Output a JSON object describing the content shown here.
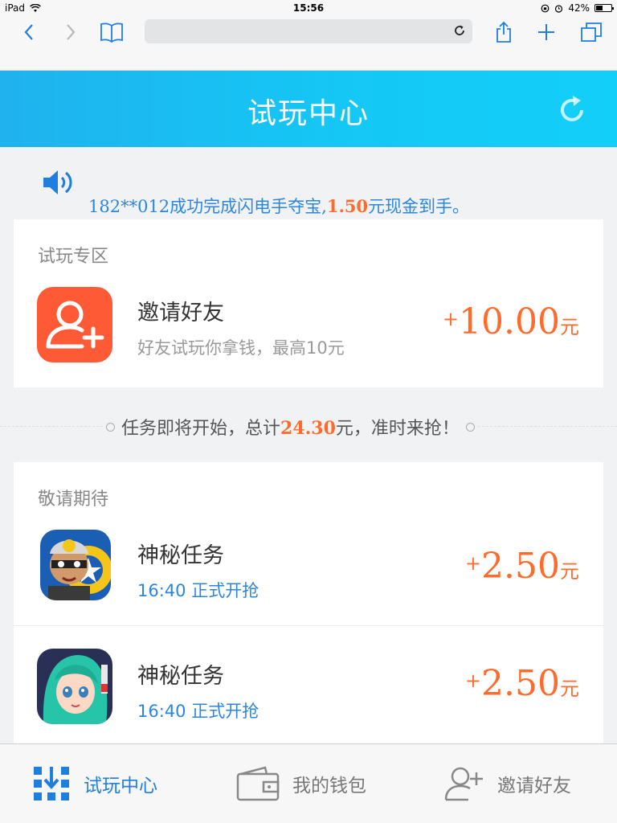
{
  "status_bar": {
    "device": "iPad",
    "time": "15:56",
    "battery": "42%"
  },
  "browser": {
    "url": ""
  },
  "header": {
    "title": "试玩中心"
  },
  "notice": {
    "prefix": "182**012成功完成闪电手夺宝,",
    "amount": "1.50",
    "suffix": "元现金到手。"
  },
  "trial_section": {
    "title": "试玩专区",
    "items": [
      {
        "title": "邀请好友",
        "subtitle": "好友试玩你拿钱，最高10元",
        "reward_sign": "+",
        "reward_value": "10.00",
        "reward_unit": "元"
      }
    ]
  },
  "upcoming_tip": {
    "prefix": "任务即将开始，总计",
    "amount": "24.30",
    "suffix": "元，准时来抢！"
  },
  "upcoming_section": {
    "title": "敬请期待",
    "items": [
      {
        "title": "神秘任务",
        "subtitle": "16:40 正式开抢",
        "reward_sign": "+",
        "reward_value": "2.50",
        "reward_unit": "元",
        "icon": "game-icon-masked-hero"
      },
      {
        "title": "神秘任务",
        "subtitle": "16:40 正式开抢",
        "reward_sign": "+",
        "reward_value": "2.50",
        "reward_unit": "元",
        "icon": "game-icon-green-hair-girl"
      }
    ]
  },
  "tabbar": {
    "tabs": [
      {
        "label": "试玩中心",
        "icon": "grid-download-icon",
        "active": true
      },
      {
        "label": "我的钱包",
        "icon": "wallet-icon",
        "active": false
      },
      {
        "label": "邀请好友",
        "icon": "add-user-icon",
        "active": false
      }
    ]
  },
  "colors": {
    "accent_blue": "#2a86de",
    "reward_orange": "#ff6b2b",
    "header_blue": "#1fb2ee",
    "invite_icon_red": "#ff5a36"
  }
}
